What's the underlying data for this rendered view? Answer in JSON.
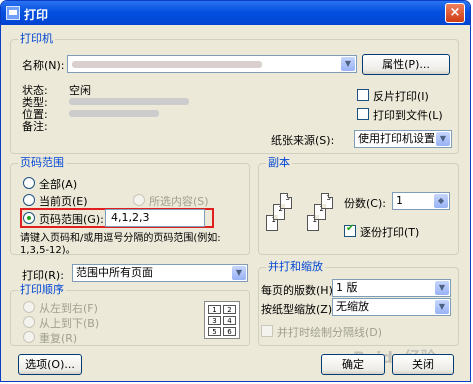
{
  "window": {
    "title": "打印",
    "close_icon": "×"
  },
  "printer": {
    "group_title": "打印机",
    "name_label": "名称(N):",
    "properties_button": "属性(P)...",
    "status_label": "状态:",
    "status_value": "空闲",
    "type_label": "类型:",
    "location_label": "位置:",
    "comment_label": "备注:",
    "print_reverse": "反片打印(I)",
    "print_to_file": "打印到文件(L)",
    "paper_source_label": "纸张来源(S):",
    "paper_source_value": "使用打印机设置"
  },
  "page_range": {
    "group_title": "页码范围",
    "all": "全部(A)",
    "current": "当前页(E)",
    "selection": "所选内容(S)",
    "pages": "页码范围(G):",
    "pages_value": "4,1,2,3",
    "hint_line1": "请键入页码和/或用逗号分隔的页码范围(例如:",
    "hint_line2": "1,3,5-12)。"
  },
  "copies": {
    "group_title": "副本",
    "count_label": "份数(C):",
    "count_value": "1",
    "collate": "逐份打印(T)"
  },
  "print_what": {
    "label": "打印(R):",
    "value": "范围中所有页面"
  },
  "print_order": {
    "group_title": "打印顺序",
    "left_to_right": "从左到右(F)",
    "top_to_bottom": "从上到下(B)",
    "repeat": "重复(R)",
    "grid": [
      "1",
      "2",
      "3",
      "4",
      "5",
      "6"
    ]
  },
  "zoom": {
    "group_title": "并打和缩放",
    "pages_per_sheet_label": "每页的版数(H):",
    "pages_per_sheet_value": "1 版",
    "scale_label": "按纸型缩放(Z):",
    "scale_value": "无缩放",
    "draw_lines": "并打时绘制分隔线(D)"
  },
  "footer": {
    "options_button": "选项(O)...",
    "ok_button": "确定",
    "close_button": "关闭",
    "watermark": "Baidu经验"
  },
  "colors": {
    "title_bar": "#0550e0",
    "group_title": "#0046d5",
    "highlight_border": "#e02020",
    "check": "#21a121"
  }
}
